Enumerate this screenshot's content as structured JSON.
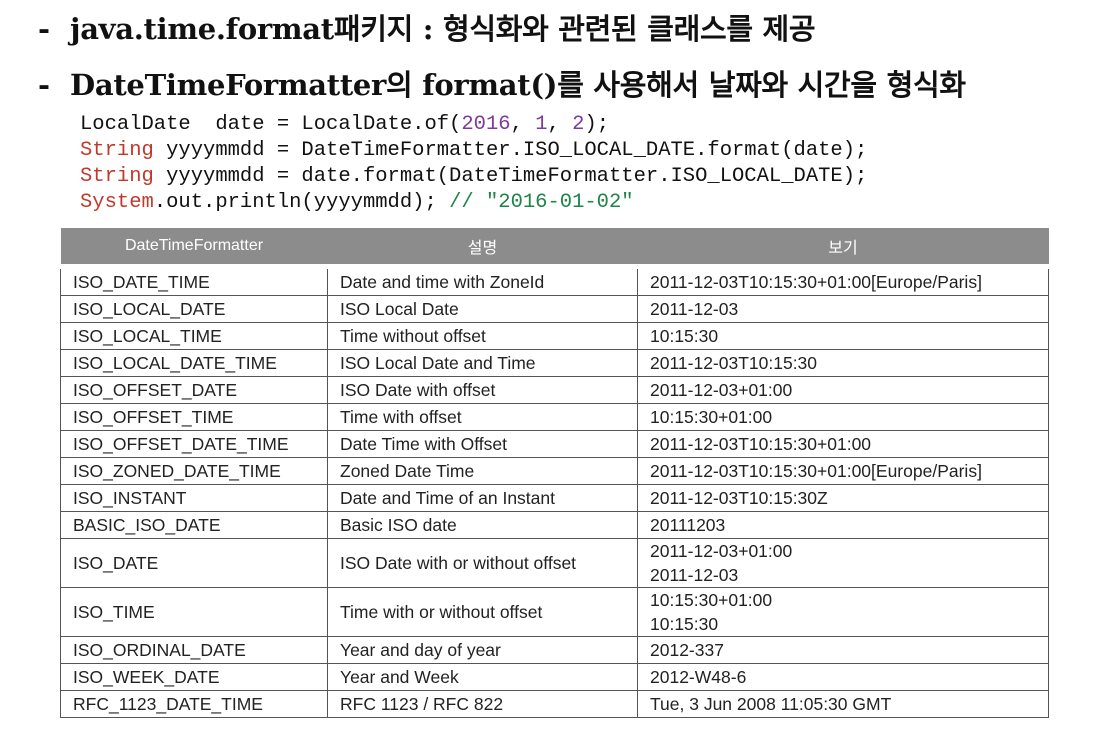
{
  "bullets": {
    "dash": "-",
    "line1": "java.time.format패키지 : 형식화와 관련된 클래스를 제공",
    "line2": "DateTimeFormatter의 format()를 사용해서 날짜와 시간을 형식화"
  },
  "code": {
    "l1_a": "LocalDate  date = LocalDate.of(",
    "l1_n1": "2016",
    "l1_sep1": ", ",
    "l1_n2": "1",
    "l1_sep2": ", ",
    "l1_n3": "2",
    "l1_end": ");",
    "l2_type": "String",
    "l2_rest": " yyyymmdd = DateTimeFormatter.ISO_LOCAL_DATE.format(date);",
    "l3_type": "String",
    "l3_rest": " yyyymmdd = date.format(DateTimeFormatter.ISO_LOCAL_DATE);",
    "l4_type": "System",
    "l4_rest": ".out.println(yyyymmdd); ",
    "l4_comment": "// \"2016-01-02\""
  },
  "table": {
    "headers": [
      "DateTimeFormatter",
      "설명",
      "보기"
    ],
    "rows": [
      [
        "ISO_DATE_TIME",
        "Date and time with ZoneId",
        "2011-12-03T10:15:30+01:00[Europe/Paris]"
      ],
      [
        "ISO_LOCAL_DATE",
        "ISO Local Date",
        "2011-12-03"
      ],
      [
        "ISO_LOCAL_TIME",
        "Time without offset",
        "10:15:30"
      ],
      [
        "ISO_LOCAL_DATE_TIME",
        "ISO Local Date and Time",
        "2011-12-03T10:15:30"
      ],
      [
        "ISO_OFFSET_DATE",
        "ISO Date with offset",
        "2011-12-03+01:00"
      ],
      [
        "ISO_OFFSET_TIME",
        "Time with offset",
        "10:15:30+01:00"
      ],
      [
        "ISO_OFFSET_DATE_TIME",
        "Date Time with Offset",
        "2011-12-03T10:15:30+01:00"
      ],
      [
        "ISO_ZONED_DATE_TIME",
        "Zoned Date Time",
        "2011-12-03T10:15:30+01:00[Europe/Paris]"
      ],
      [
        "ISO_INSTANT",
        "Date and Time of an Instant",
        "2011-12-03T10:15:30Z"
      ],
      [
        "BASIC_ISO_DATE",
        "Basic ISO date",
        "20111203"
      ],
      [
        "ISO_DATE",
        "ISO Date with or without offset",
        [
          "2011-12-03+01:00",
          "2011-12-03"
        ]
      ],
      [
        "ISO_TIME",
        "Time with or without offset",
        [
          "10:15:30+01:00",
          "10:15:30"
        ]
      ],
      [
        "ISO_ORDINAL_DATE",
        "Year and day of year",
        "2012-337"
      ],
      [
        "ISO_WEEK_DATE",
        "Year and Week",
        "2012-W48-6"
      ],
      [
        "RFC_1123_DATE_TIME",
        "RFC 1123 / RFC 822",
        "Tue, 3 Jun 2008 11:05:30 GMT"
      ]
    ]
  },
  "colors": {
    "header_bg": "#8c8c8c",
    "code_type": "#c0392b",
    "code_number": "#7d3c98",
    "code_comment": "#1e8449"
  }
}
